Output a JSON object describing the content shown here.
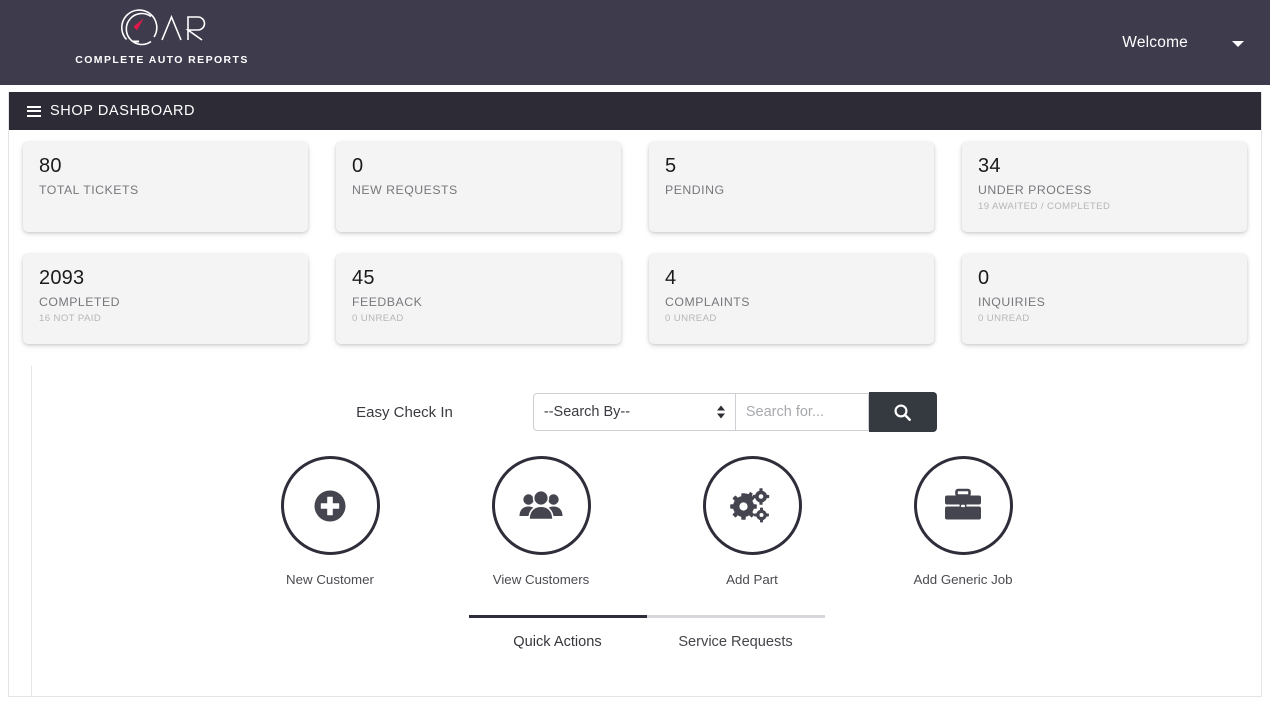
{
  "header": {
    "brand_name": "CAR",
    "brand_tagline": "COMPLETE AUTO REPORTS",
    "welcome_label": "Welcome",
    "caret_icon": "chevron-down-icon",
    "bg_color": "#3e3b4d"
  },
  "dashbar": {
    "menu_icon": "hamburger-icon",
    "title": "SHOP DASHBOARD",
    "bg_color": "#2c2b36"
  },
  "stats": {
    "row1": [
      {
        "value": "80",
        "label": "TOTAL TICKETS",
        "sub": ""
      },
      {
        "value": "0",
        "label": "NEW REQUESTS",
        "sub": ""
      },
      {
        "value": "5",
        "label": "PENDING",
        "sub": ""
      },
      {
        "value": "34",
        "label": "UNDER PROCESS",
        "sub": "19 AWAITED / COMPLETED"
      }
    ],
    "row2": [
      {
        "value": "2093",
        "label": "COMPLETED",
        "sub": "16 NOT PAID"
      },
      {
        "value": "45",
        "label": "FEEDBACK",
        "sub": "0 UNREAD"
      },
      {
        "value": "4",
        "label": "COMPLAINTS",
        "sub": "0 UNREAD"
      },
      {
        "value": "0",
        "label": "INQUIRIES",
        "sub": "0 UNREAD"
      }
    ]
  },
  "checkin": {
    "label": "Easy Check In",
    "select_value": "--Search By--",
    "select_options": [
      "--Search By--"
    ],
    "search_value": "",
    "search_placeholder": "Search for...",
    "search_button_icon": "search-icon",
    "search_button_color": "#343a40"
  },
  "quick_actions": [
    {
      "label": "New Customer",
      "icon": "plus-circle-icon"
    },
    {
      "label": "View Customers",
      "icon": "users-icon"
    },
    {
      "label": "Add Part",
      "icon": "gears-icon"
    },
    {
      "label": "Add Generic Job",
      "icon": "briefcase-icon"
    }
  ],
  "tabs": [
    {
      "label": "Quick Actions",
      "active": true
    },
    {
      "label": "Service Requests",
      "active": false
    }
  ]
}
